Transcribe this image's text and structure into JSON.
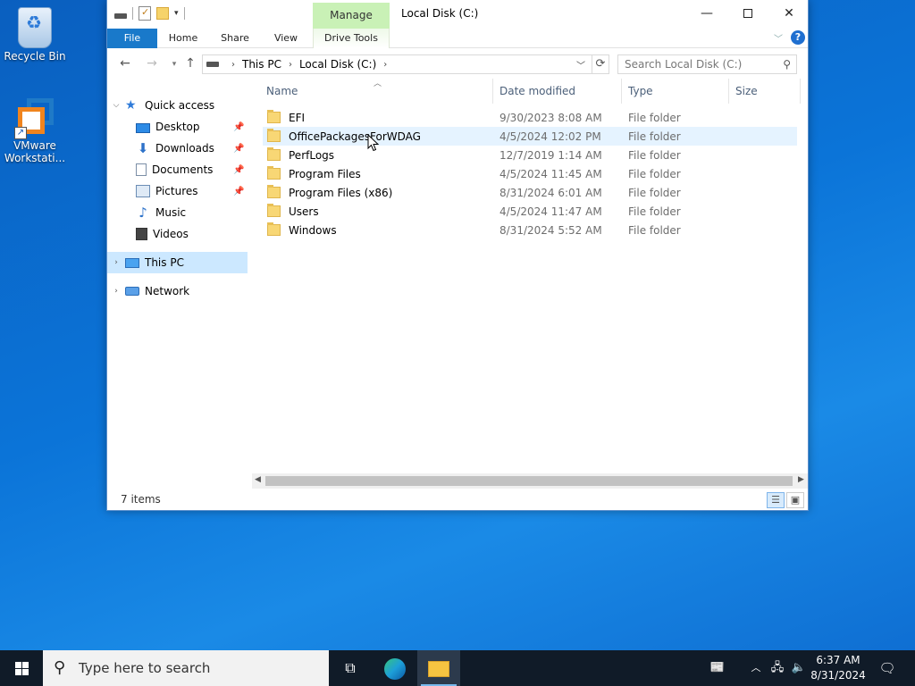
{
  "desktop": {
    "icons": [
      {
        "label": "Recycle Bin"
      },
      {
        "label": "VMware Workstati..."
      }
    ]
  },
  "window": {
    "title": "Local Disk (C:)",
    "contextual_tab": "Manage",
    "ribbon_tabs": [
      "File",
      "Home",
      "Share",
      "View",
      "Drive Tools"
    ],
    "controls": {
      "minimize": "—",
      "close": "✕"
    },
    "help": "?"
  },
  "address": {
    "segments": [
      "This PC",
      "Local Disk (C:)"
    ],
    "search_placeholder": "Search Local Disk (C:)"
  },
  "nav": {
    "quick_access": "Quick access",
    "items": [
      {
        "label": "Desktop",
        "pinned": true
      },
      {
        "label": "Downloads",
        "pinned": true
      },
      {
        "label": "Documents",
        "pinned": true
      },
      {
        "label": "Pictures",
        "pinned": true
      },
      {
        "label": "Music",
        "pinned": false
      },
      {
        "label": "Videos",
        "pinned": false
      }
    ],
    "this_pc": "This PC",
    "network": "Network"
  },
  "columns": {
    "name": "Name",
    "date": "Date modified",
    "type": "Type",
    "size": "Size"
  },
  "files": [
    {
      "name": "EFI",
      "date": "9/30/2023 8:08 AM",
      "type": "File folder"
    },
    {
      "name": "OfficePackagesForWDAG",
      "date": "4/5/2024 12:02 PM",
      "type": "File folder"
    },
    {
      "name": "PerfLogs",
      "date": "12/7/2019 1:14 AM",
      "type": "File folder"
    },
    {
      "name": "Program Files",
      "date": "4/5/2024 11:45 AM",
      "type": "File folder"
    },
    {
      "name": "Program Files (x86)",
      "date": "8/31/2024 6:01 AM",
      "type": "File folder"
    },
    {
      "name": "Users",
      "date": "4/5/2024 11:47 AM",
      "type": "File folder"
    },
    {
      "name": "Windows",
      "date": "8/31/2024 5:52 AM",
      "type": "File folder"
    }
  ],
  "status": {
    "count": "7 items"
  },
  "taskbar": {
    "search_placeholder": "Type here to search",
    "time": "6:37 AM",
    "date": "8/31/2024"
  },
  "colors": {
    "accent": "#1979ca",
    "selection": "#cce8ff",
    "hover": "#e5f3ff",
    "manage": "#c9f1b6"
  }
}
